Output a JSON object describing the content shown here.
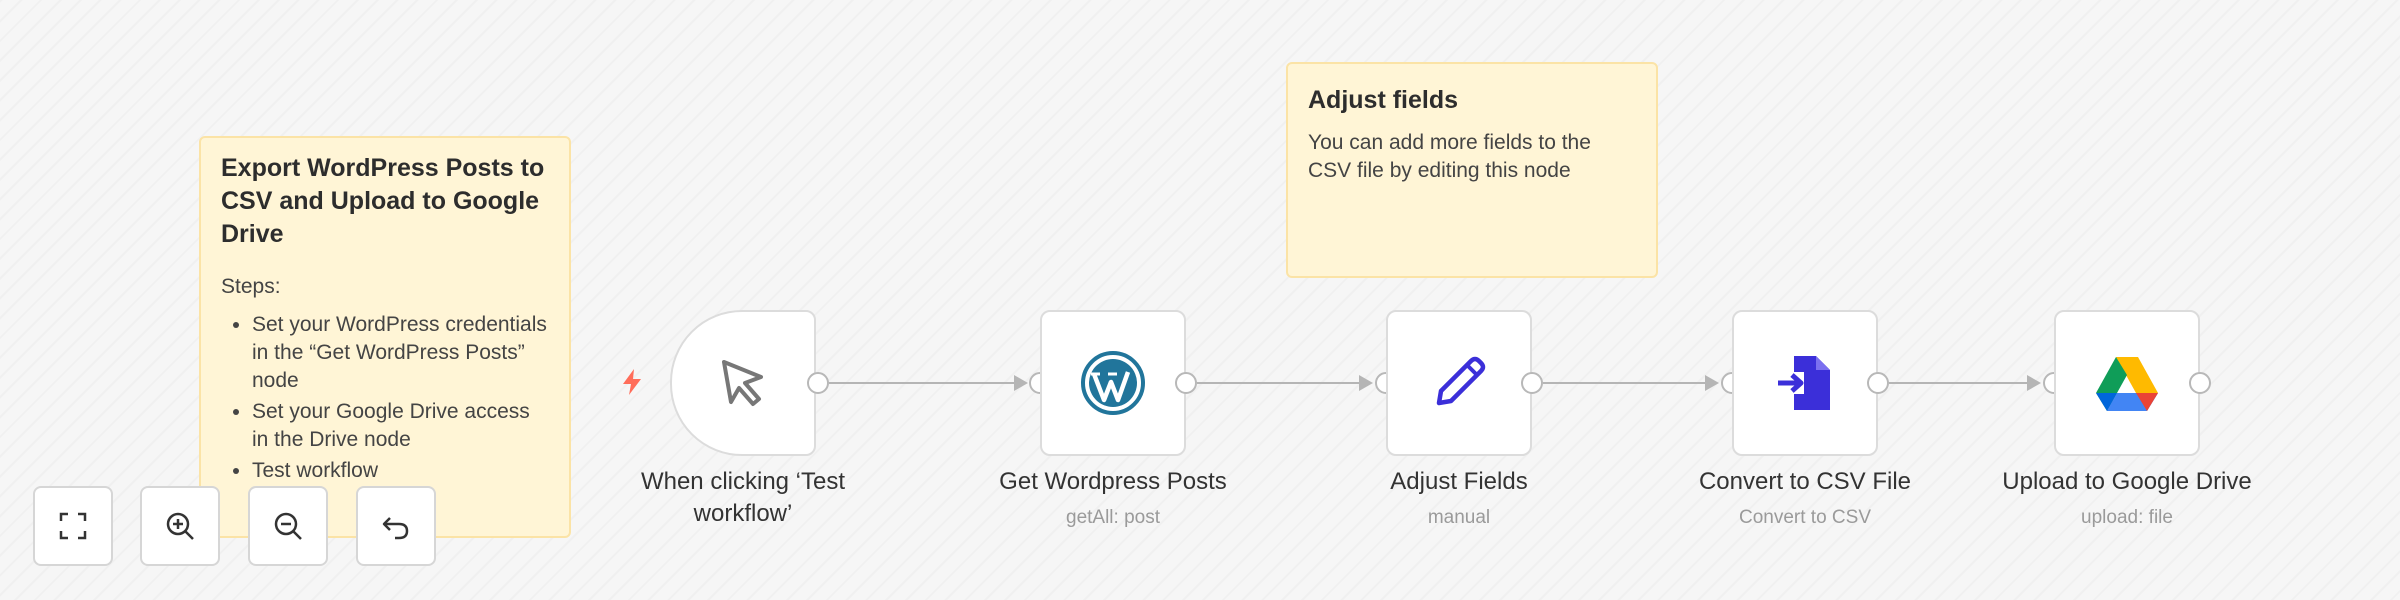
{
  "sticky_notes": [
    {
      "title": "Export WordPress Posts to CSV and Upload to Google Drive",
      "steps_label": "Steps:",
      "steps": [
        "Set your WordPress credentials in the “Get WordPress Posts” node",
        "Set your Google Drive access in the Drive node",
        "Test workflow"
      ]
    },
    {
      "title": "Adjust fields",
      "text": "You can add more fields to the CSV file by editing this node"
    }
  ],
  "nodes": [
    {
      "label": "When clicking ‘Test workflow’",
      "icon": "cursor-icon"
    },
    {
      "label": "Get Wordpress Posts",
      "subtitle": "getAll: post",
      "icon": "wordpress-icon"
    },
    {
      "label": "Adjust Fields",
      "subtitle": "manual",
      "icon": "pencil-icon"
    },
    {
      "label": "Convert to CSV File",
      "subtitle": "Convert to CSV",
      "icon": "convert-file-icon"
    },
    {
      "label": "Upload to Google Drive",
      "subtitle": "upload: file",
      "icon": "google-drive-icon"
    }
  ],
  "controls": [
    {
      "name": "fit-view",
      "icon": "fullscreen-icon"
    },
    {
      "name": "zoom-in",
      "icon": "zoom-in-icon"
    },
    {
      "name": "zoom-out",
      "icon": "zoom-out-icon"
    },
    {
      "name": "reset-zoom",
      "icon": "undo-icon"
    }
  ],
  "colors": {
    "sticky_bg": "#fff5d6",
    "sticky_border": "#fbe3a6",
    "trigger_bolt": "#ff6d5a",
    "pencil": "#3b2fd9",
    "convert": "#3b2fd9",
    "wordpress": "#21759b"
  }
}
